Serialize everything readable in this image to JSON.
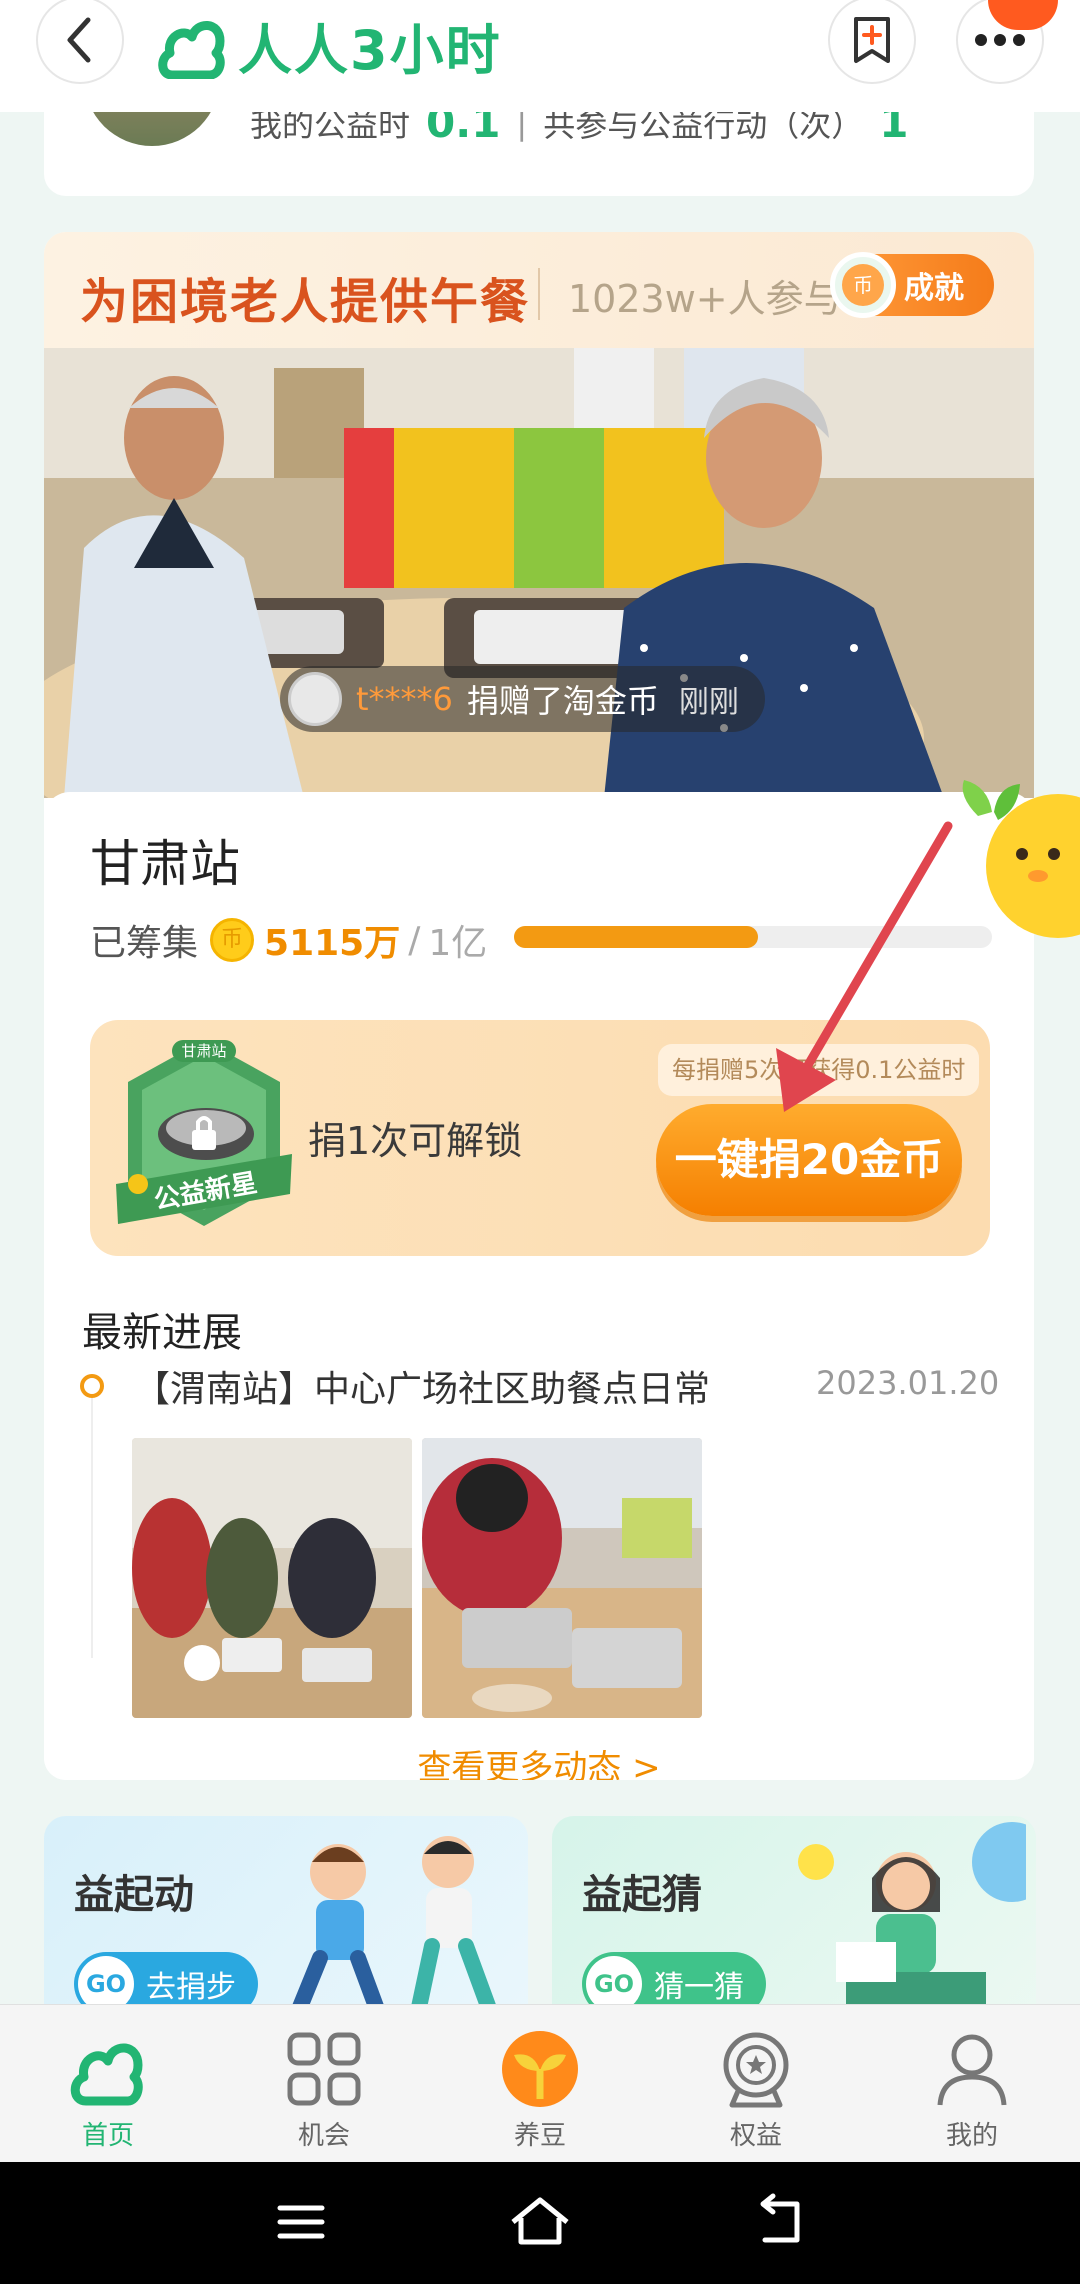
{
  "header": {
    "app_name": "人人3小时",
    "back_icon": "back-chevron-icon",
    "bookmark_icon": "bookmark-plus-icon",
    "more_icon": "more-dots-icon"
  },
  "profile": {
    "hours_label": "我的公益时",
    "hours_value": "0.1",
    "separator": "|",
    "actions_label": "共参与公益行动（次）",
    "actions_value": "1"
  },
  "project": {
    "title": "为困境老人提供午餐",
    "participants": "1023w+人参与",
    "achievement_label": "成就",
    "ticker": {
      "user": "t****6",
      "action": "捐赠了淘金币",
      "time": "刚刚"
    },
    "station": "甘肃站",
    "raised_label": "已筹集",
    "raised_amount": "5115万",
    "raised_separator": "/",
    "raised_target": "1亿",
    "progress_fraction": 0.51,
    "medal_top_text": "甘肃站",
    "medal_ribbon_text": "公益新星",
    "unlock_text": "捐1次可解锁",
    "donate_hint": "每捐赠5次可获得0.1公益时",
    "donate_button": "一键捐20金币"
  },
  "news": {
    "section_title": "最新进展",
    "headline": "【渭南站】中心广场社区助餐点日常",
    "date": "2023.01.20",
    "more_link": "查看更多动态 >"
  },
  "mini_cards": [
    {
      "title": "益起动",
      "go": "GO",
      "button": "去捐步"
    },
    {
      "title": "益起猜",
      "go": "GO",
      "button": "猜一猜"
    }
  ],
  "nav": [
    {
      "label": "首页",
      "icon": "home-cloud-icon",
      "active": true
    },
    {
      "label": "机会",
      "icon": "grid-icon",
      "active": false
    },
    {
      "label": "养豆",
      "icon": "sprout-icon",
      "active": false
    },
    {
      "label": "权益",
      "icon": "star-badge-icon",
      "active": false
    },
    {
      "label": "我的",
      "icon": "person-icon",
      "active": false
    }
  ],
  "colors": {
    "brand_green": "#22b573",
    "accent_orange": "#f39a12",
    "title_orange": "#d9531e",
    "arrow_red": "#e0454e"
  }
}
